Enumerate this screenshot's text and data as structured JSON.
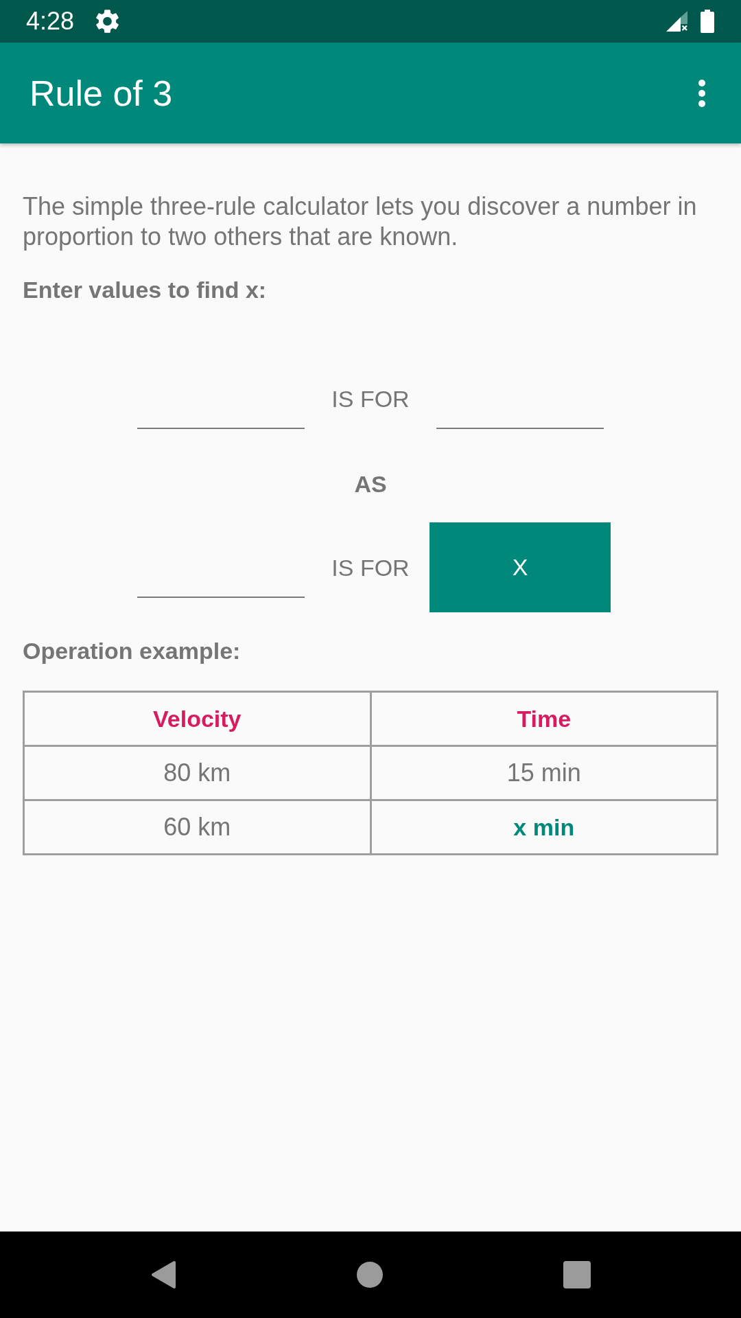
{
  "status_bar": {
    "time": "4:28"
  },
  "app_bar": {
    "title": "Rule of 3"
  },
  "description": "The simple three-rule calculator lets you discover a number in proportion to two others that are known.",
  "calculator": {
    "heading": "Enter values to find x:",
    "first_ratio": {
      "relation": "IS FOR"
    },
    "joiner": "AS",
    "second_ratio": {
      "relation": "IS FOR",
      "button": "X"
    }
  },
  "example": {
    "heading": "Operation example:",
    "columns": [
      "Velocity",
      "Time"
    ],
    "rows": [
      {
        "cells": [
          {
            "text": "80 km",
            "highlighted": false
          },
          {
            "text": "15 min",
            "highlighted": false
          }
        ]
      },
      {
        "cells": [
          {
            "text": "60 km",
            "highlighted": false
          },
          {
            "text": "x min",
            "highlighted": true
          }
        ]
      }
    ]
  }
}
